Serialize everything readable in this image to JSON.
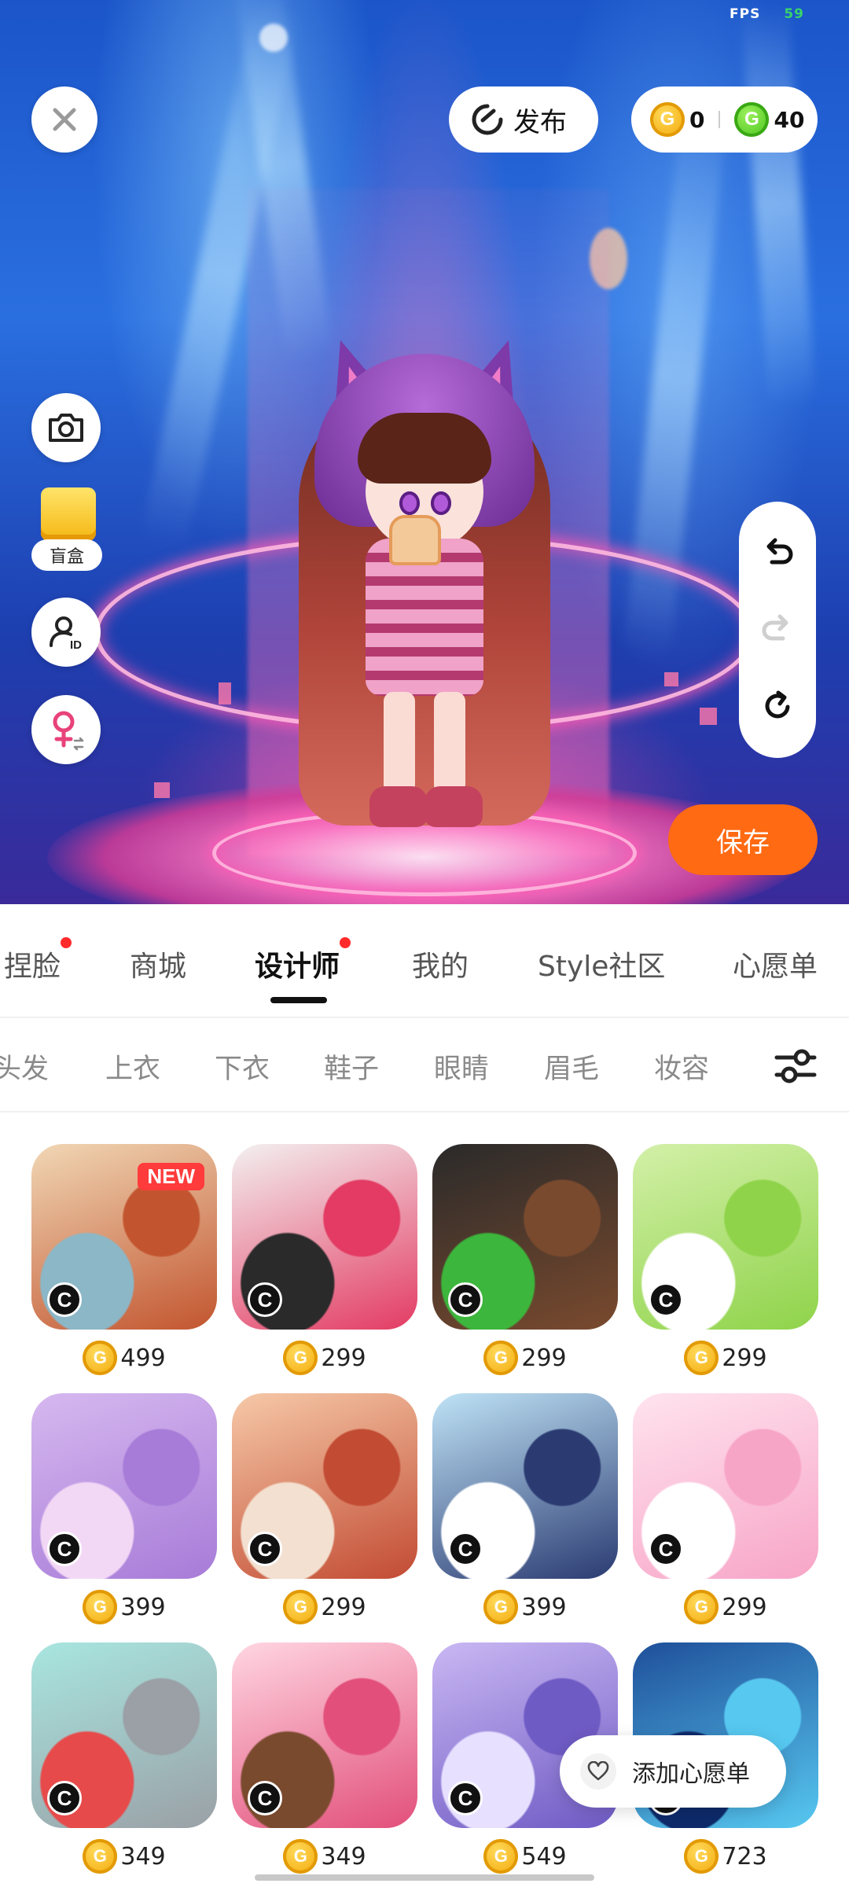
{
  "status": {
    "fps_label": "FPS",
    "fps_value": "59"
  },
  "top_bar": {
    "close_icon": "close-icon",
    "publish_label": "发布",
    "gold_coins": "0",
    "green_coins": "40",
    "coin_glyph": "G"
  },
  "left_tools": {
    "camera_icon": "camera-icon",
    "blind_box_label": "盲盒",
    "profile_id_icon": "profile-id-icon",
    "gender_icon": "female-gender-swap-icon"
  },
  "right_tools": {
    "undo_icon": "undo-icon",
    "redo_icon": "redo-icon",
    "reset_icon": "reset-icon"
  },
  "save_label": "保存",
  "main_tabs": [
    {
      "label": "捏脸",
      "dot": true
    },
    {
      "label": "商城",
      "dot": false
    },
    {
      "label": "设计师",
      "dot": true,
      "active": true
    },
    {
      "label": "我的",
      "dot": false
    },
    {
      "label": "Style社区",
      "dot": false
    },
    {
      "label": "心愿单",
      "dot": false
    }
  ],
  "categories": [
    "头发",
    "上衣",
    "下衣",
    "鞋子",
    "眼睛",
    "眉毛",
    "妆容"
  ],
  "filter_icon": "filter-sliders-icon",
  "creator_badge": "C",
  "new_badge": "NEW",
  "items": [
    {
      "price": "499",
      "new": true,
      "colors": [
        "#f1d7b5",
        "#c2552f",
        "#8bb7c7"
      ]
    },
    {
      "price": "299",
      "new": false,
      "colors": [
        "#f3f0f0",
        "#e33b63",
        "#2a2a2a"
      ]
    },
    {
      "price": "299",
      "new": false,
      "colors": [
        "#2a2a2a",
        "#7a4a2e",
        "#3cb63c"
      ]
    },
    {
      "price": "299",
      "new": false,
      "colors": [
        "#d3f0a8",
        "#8fd34a",
        "#ffffff"
      ]
    },
    {
      "price": "399",
      "new": false,
      "colors": [
        "#d6b8ef",
        "#a77bd8",
        "#f3d8f5"
      ]
    },
    {
      "price": "299",
      "new": false,
      "colors": [
        "#f6c9a8",
        "#c24b33",
        "#f3e0d0"
      ]
    },
    {
      "price": "399",
      "new": false,
      "colors": [
        "#bfe3f6",
        "#2b3b72",
        "#ffffff"
      ]
    },
    {
      "price": "299",
      "new": false,
      "colors": [
        "#ffe3ee",
        "#f7a5c7",
        "#ffffff"
      ]
    },
    {
      "price": "349",
      "new": false,
      "colors": [
        "#a8e6e0",
        "#9aa0a6",
        "#e74a4a"
      ]
    },
    {
      "price": "349",
      "new": false,
      "colors": [
        "#ffd6e2",
        "#e24f7a",
        "#7a4a2e"
      ]
    },
    {
      "price": "549",
      "new": false,
      "colors": [
        "#c9b7f3",
        "#6f5bc4",
        "#e7e0ff"
      ]
    },
    {
      "price": "723",
      "new": false,
      "colors": [
        "#1f4f9a",
        "#57c8f0",
        "#0e2a6a"
      ]
    }
  ],
  "wishlist_label": "添加心愿单",
  "colors": {
    "accent": "#ff6a13",
    "badge_red": "#ff2a2a",
    "gold": "#f2a705",
    "green": "#45c21a"
  }
}
